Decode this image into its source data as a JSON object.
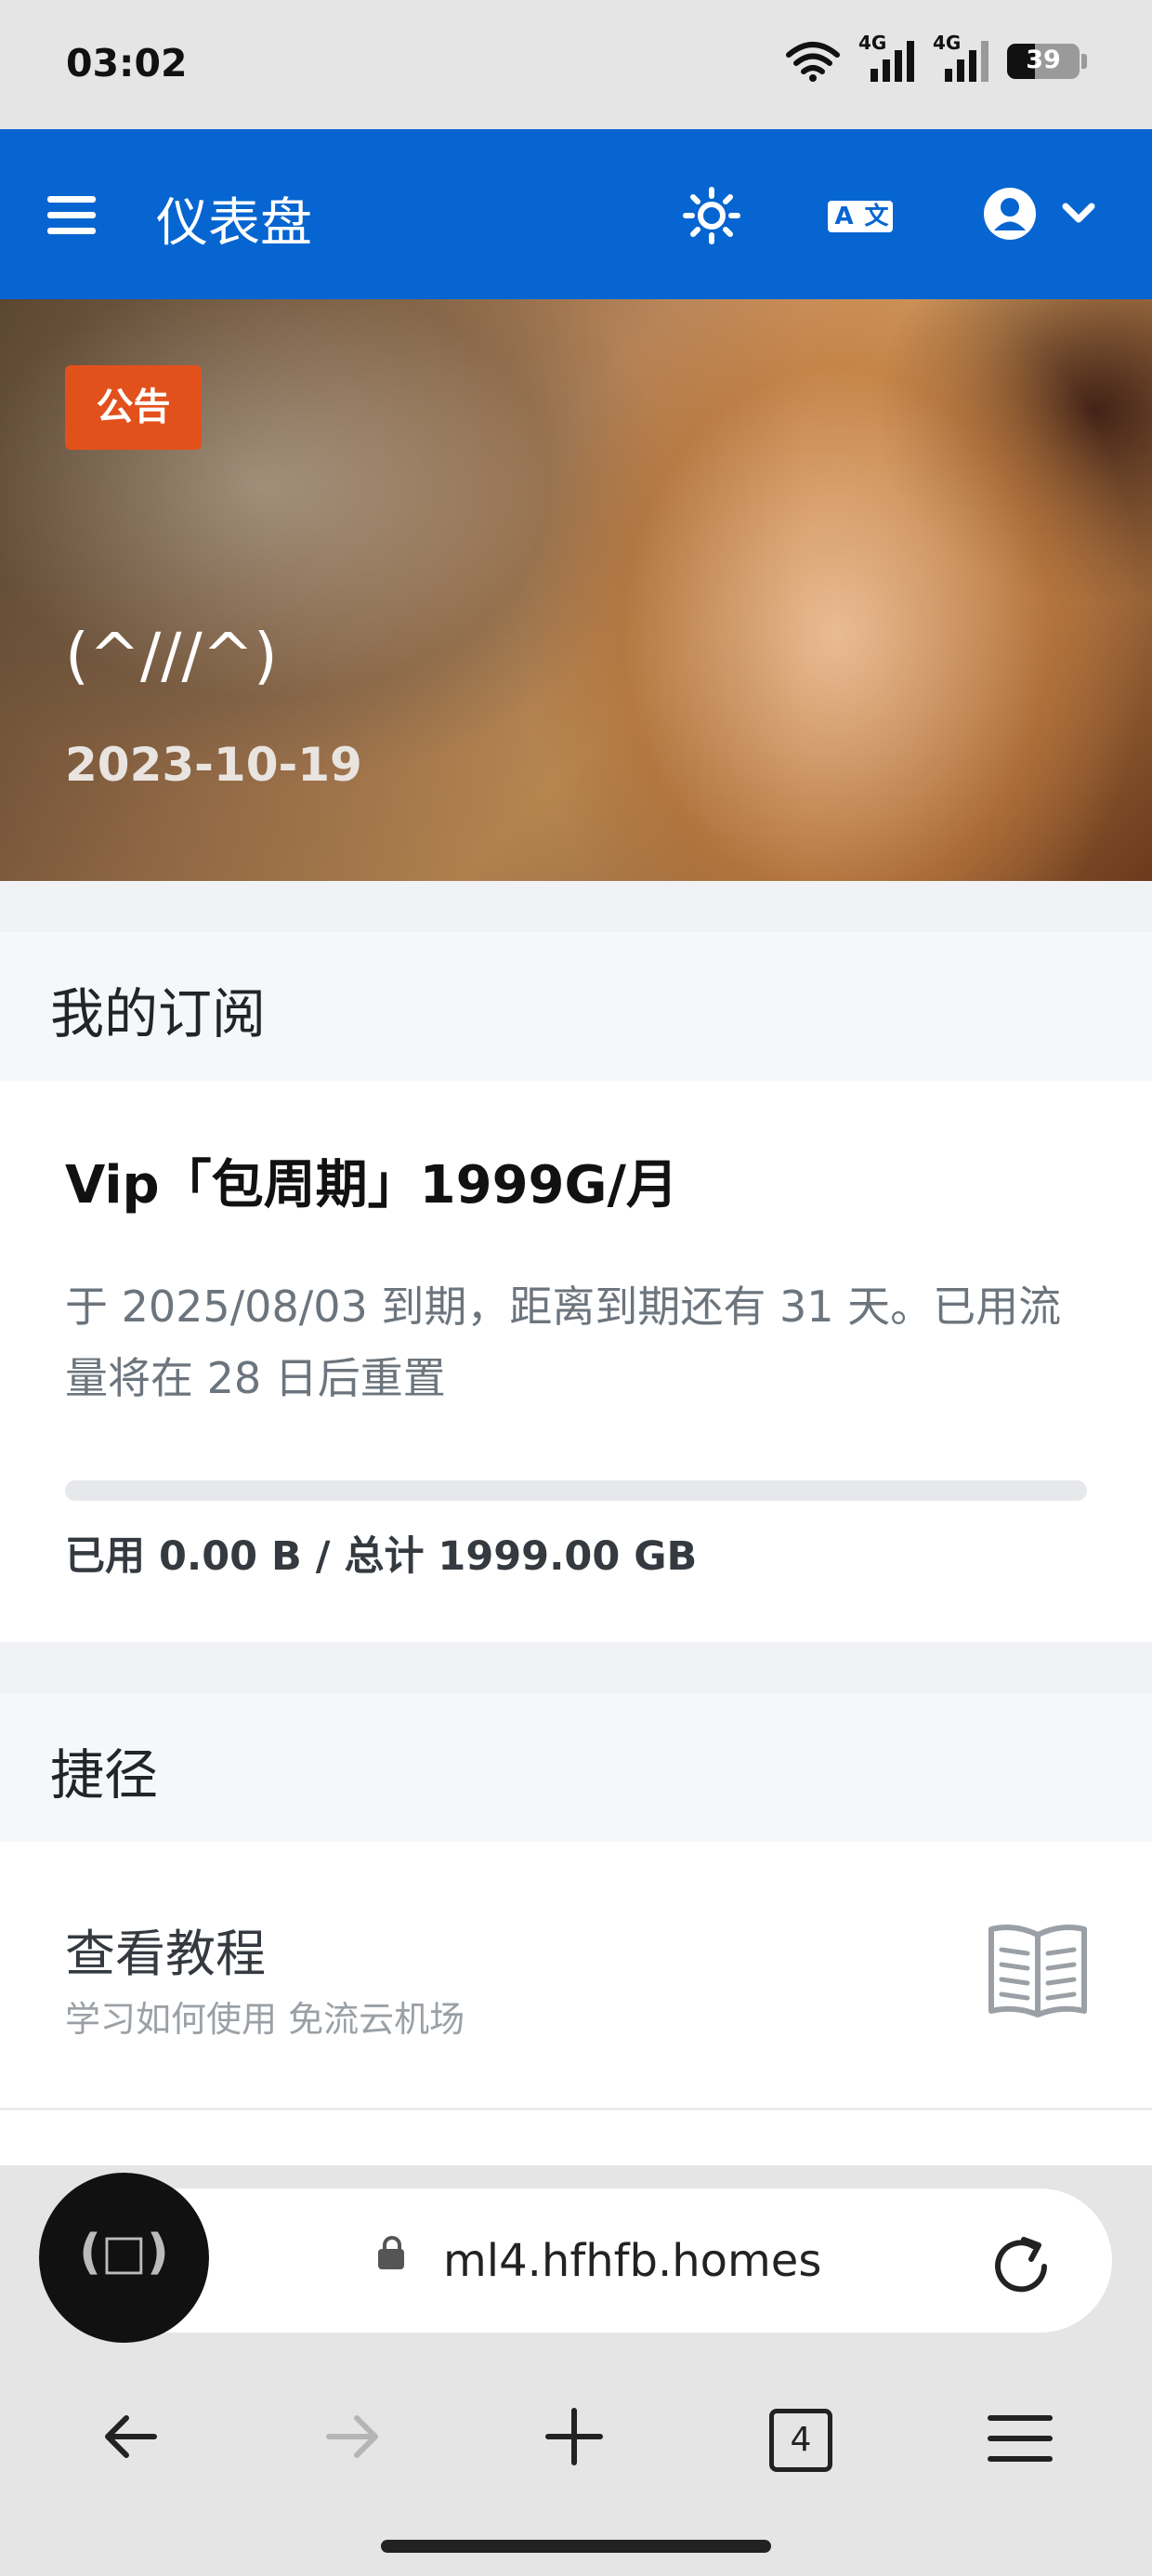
{
  "status_bar": {
    "time": "03:02",
    "network_1": "4G",
    "network_2": "4G",
    "battery": "39"
  },
  "app_bar": {
    "title": "仪表盘"
  },
  "notice": {
    "badge": "公告",
    "title": "(^///^)",
    "date": "2023-10-19"
  },
  "subscription": {
    "header": "我的订阅",
    "plan_name": "Vip「包周期」1999G/月",
    "description": "于 2025/08/03 到期，距离到期还有 31 天。已用流量将在 28 日后重置",
    "usage_fraction": 0.0,
    "usage_text": "已用 0.00 B / 总计 1999.00 GB"
  },
  "shortcuts": {
    "header": "捷径",
    "items": [
      {
        "title": "查看教程",
        "subtitle": "学习如何使用 免流云机场",
        "icon": "book-icon"
      }
    ]
  },
  "browser": {
    "url": "ml4.hfhfb.homes",
    "tab_count": "4"
  },
  "colors": {
    "primary": "#0665d0",
    "badge": "#e2511c"
  }
}
